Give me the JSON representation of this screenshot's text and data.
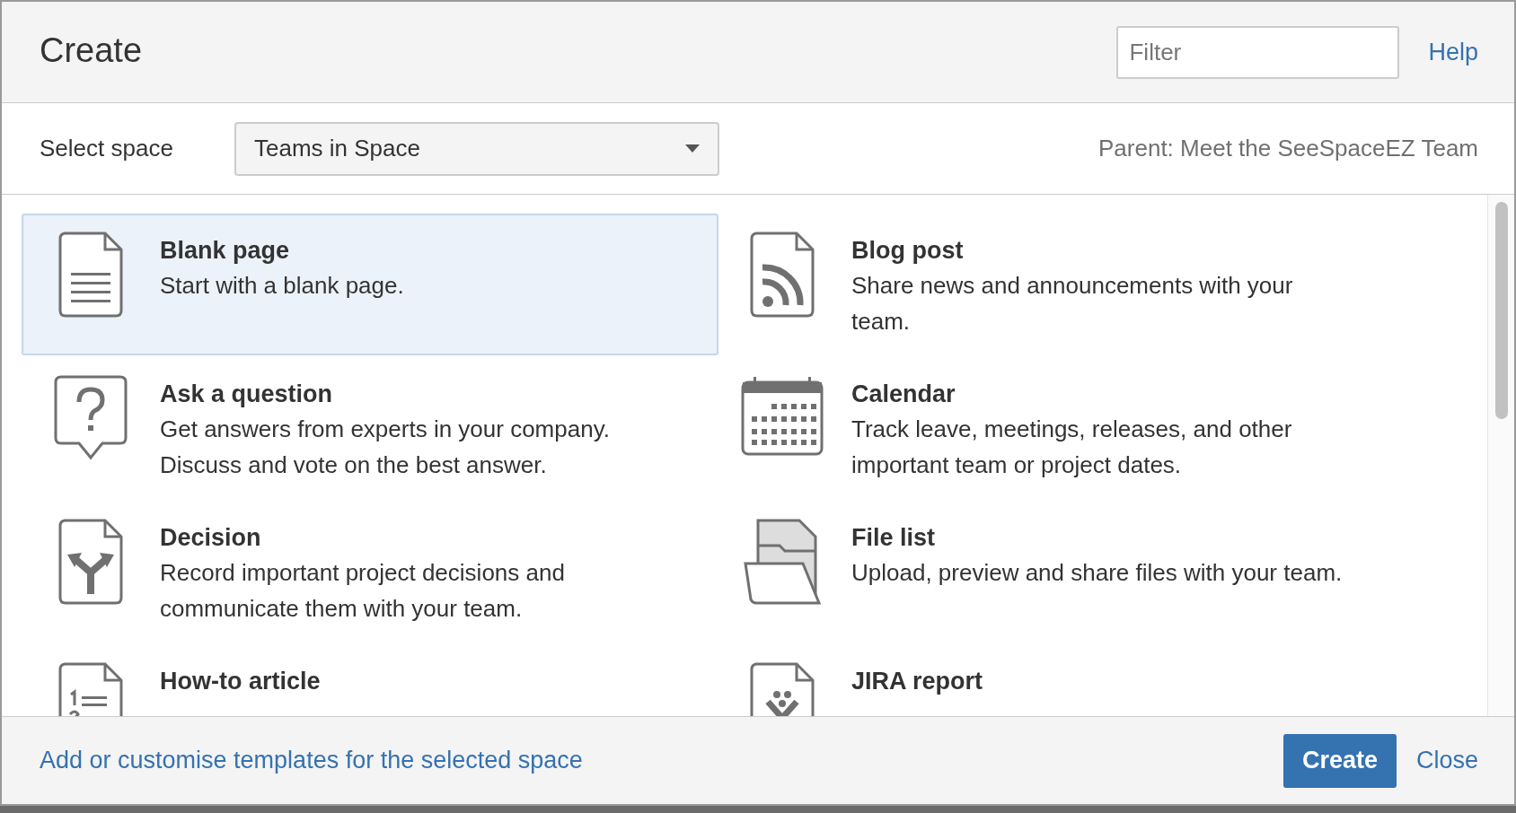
{
  "dialog": {
    "title": "Create",
    "filter": {
      "placeholder": "Filter"
    },
    "help_link": "Help"
  },
  "space_row": {
    "label": "Select space",
    "select_value": "Teams in Space",
    "parent": "Parent: Meet the SeeSpaceEZ Team"
  },
  "templates": [
    {
      "kind": "page",
      "title": "Blank page",
      "description": "Start with a blank page.",
      "selected": true
    },
    {
      "kind": "blog",
      "title": "Blog post",
      "description": "Share news and announcements with your team.",
      "selected": false
    },
    {
      "kind": "question",
      "title": "Ask a question",
      "description": "Get answers from experts in your company. Discuss and vote on the best answer.",
      "selected": false
    },
    {
      "kind": "calendar",
      "title": "Calendar",
      "description": "Track leave, meetings, releases, and other important team or project dates.",
      "selected": false
    },
    {
      "kind": "decision",
      "title": "Decision",
      "description": "Record important project decisions and communicate them with your team.",
      "selected": false
    },
    {
      "kind": "files",
      "title": "File list",
      "description": "Upload, preview and share files with your team.",
      "selected": false
    },
    {
      "kind": "howto",
      "title": "How-to article",
      "selected": false
    },
    {
      "kind": "jira",
      "title": "JIRA report",
      "selected": false
    }
  ],
  "footer": {
    "link": "Add or customise templates for the selected space",
    "primary_button": "Create",
    "close_link": "Close"
  }
}
